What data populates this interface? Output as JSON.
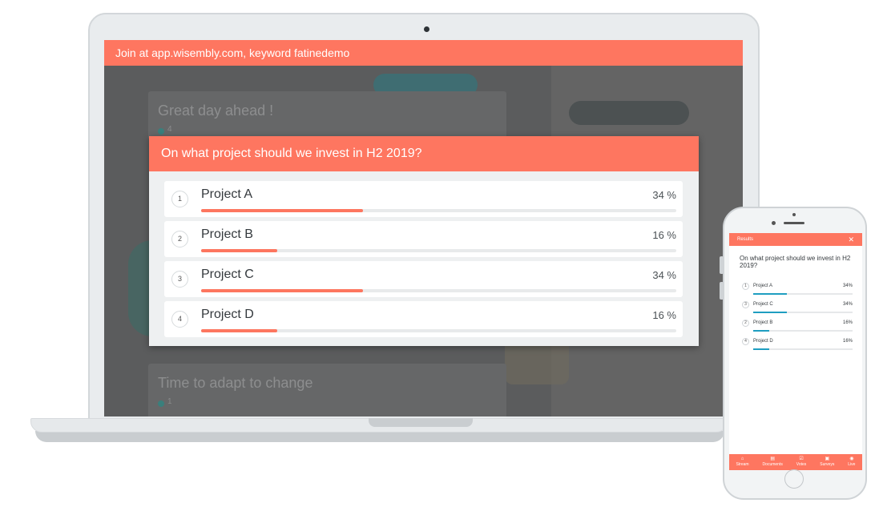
{
  "laptop": {
    "banner": "Join at app.wisembly.com, keyword fatinedemo",
    "background_cards": [
      {
        "title": "Great day ahead !",
        "count": "4"
      },
      {
        "title": "Time to adapt to change",
        "count": "1"
      }
    ],
    "poll": {
      "question": "On what project should we invest in H2 2019?",
      "options": [
        {
          "num": "1",
          "label": "Project A",
          "pct_text": "34 %",
          "fraction": 0.34
        },
        {
          "num": "2",
          "label": "Project B",
          "pct_text": "16 %",
          "fraction": 0.16
        },
        {
          "num": "3",
          "label": "Project C",
          "pct_text": "34 %",
          "fraction": 0.34
        },
        {
          "num": "4",
          "label": "Project D",
          "pct_text": "16 %",
          "fraction": 0.16
        }
      ]
    }
  },
  "phone": {
    "header": "Results",
    "close_icon": "close-icon",
    "question": "On what project should we invest in H2 2019?",
    "options": [
      {
        "num": "1",
        "label": "Project A",
        "pct_text": "34%",
        "fraction": 0.34
      },
      {
        "num": "3",
        "label": "Project C",
        "pct_text": "34%",
        "fraction": 0.34
      },
      {
        "num": "2",
        "label": "Project B",
        "pct_text": "16%",
        "fraction": 0.16
      },
      {
        "num": "4",
        "label": "Project D",
        "pct_text": "16%",
        "fraction": 0.16
      }
    ],
    "nav": [
      {
        "label": "Stream",
        "icon": "home-icon"
      },
      {
        "label": "Documents",
        "icon": "document-icon"
      },
      {
        "label": "Votes",
        "icon": "vote-icon"
      },
      {
        "label": "Surveys",
        "icon": "survey-icon"
      },
      {
        "label": "Live",
        "icon": "live-icon"
      }
    ]
  },
  "colors": {
    "accent": "#fe7660",
    "laptop_bar": "#fd765f",
    "phone_bar": "#1f9ec1"
  }
}
